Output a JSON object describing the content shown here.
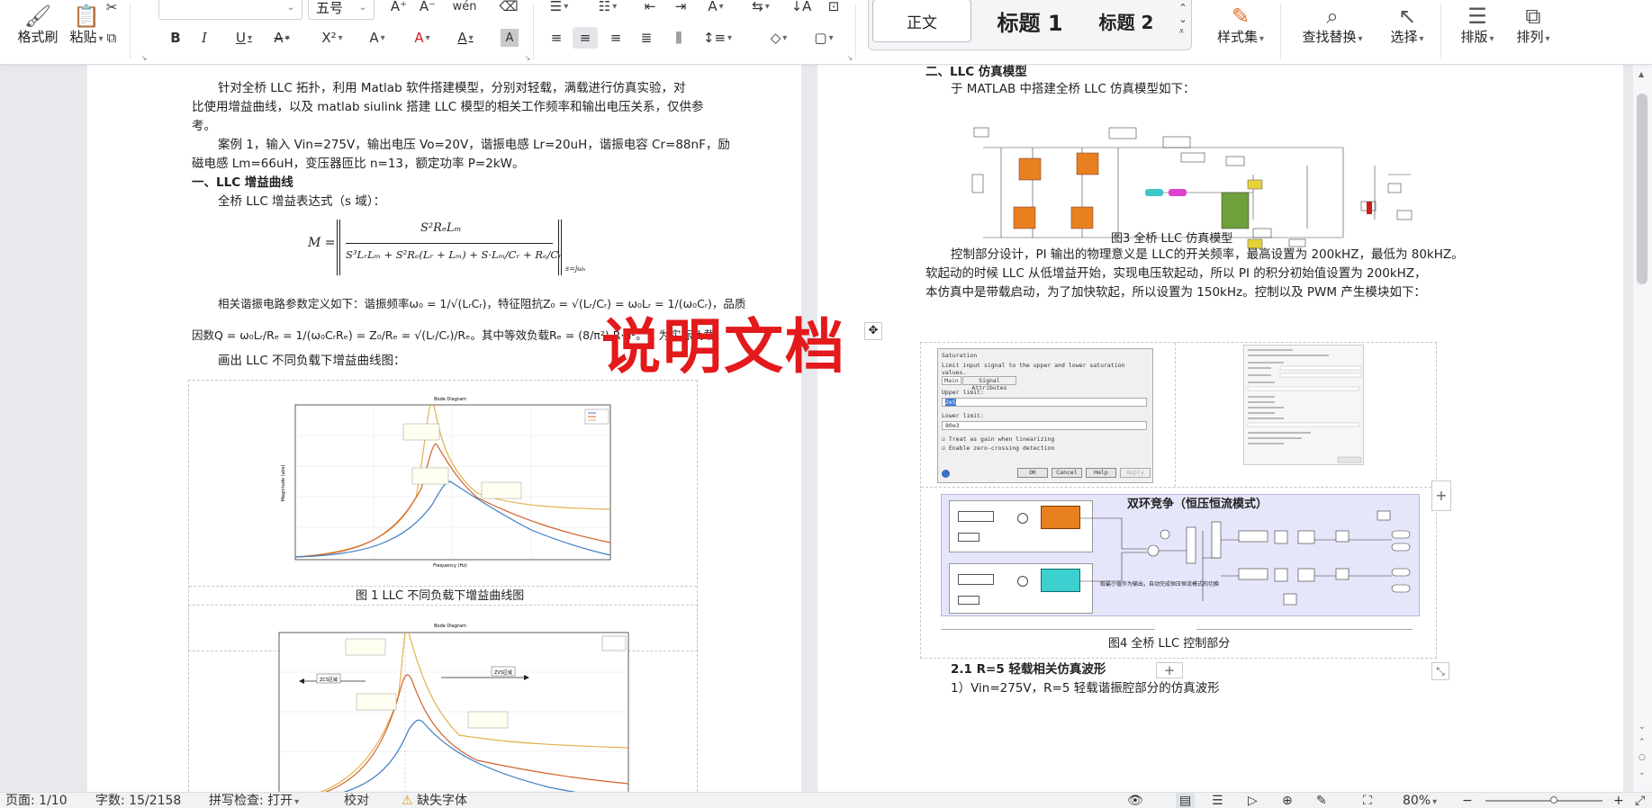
{
  "ribbon": {
    "format_painter": "格式刷",
    "paste": "粘贴",
    "font_name": "",
    "font_size": "五号",
    "style_normal": "正文",
    "style_h1": "标题 1",
    "style_h2": "标题 2",
    "style_set": "样式集",
    "find_replace": "查找替换",
    "select": "选择",
    "layout": "排版",
    "arrange": "排列"
  },
  "left_page": {
    "p1_l1": "针对全桥 LLC 拓扑，利用 Matlab 软件搭建模型，分别对轻载，满载进行仿真实验，对",
    "p1_l2": "比使用增益曲线，以及 matlab siulink 搭建 LLC 模型的相关工作频率和输出电压关系，仅供参",
    "p1_l3": "考。",
    "p2_l1": "案例 1，输入 Vin=275V，输出电压 Vo=20V，谐振电感 Lr=20uH，谐振电容 Cr=88nF，励",
    "p2_l2": "磁电感 Lm=66uH，变压器匝比 n=13，额定功率 P=2kW。",
    "h1": "一、LLC 增益曲线",
    "p3": "全桥 LLC 增益表达式（s 域）：",
    "formula_m": "M =",
    "formula_num": "S²RₑLₘ",
    "formula_den": "S³LᵣLₘ + S²Rₑ(Lᵣ + Lₘ) + S·Lₘ/Cᵣ + Rₑ/Cᵣ",
    "formula_sub": "s=jωₛ",
    "p4_l1": "相关谐振电路参数定义如下：谐振频率ω₀ = 1/√(LᵣCᵣ)，特征阻抗Z₀ = √(Lᵣ/Cᵣ) = ω₀Lᵣ = 1/(ω₀Cᵣ)，品质",
    "p4_l2": "因数Q = ω₀Lᵣ/Rₑ = 1/(ω₀CᵣRₑ) = Z₀/Rₑ = √(Lᵣ/Cᵣ)/Rₑ。其中等效负载Rₑ = (8/π²)·R·n²。R 为实际负载。",
    "p5": "画出 LLC 不同负载下增益曲线图：",
    "fig1_caption": "图 1 LLC 不同负载下增益曲线图",
    "plot1_title": "Bode Diagram",
    "plot1_xlabel": "Frequency (Hz)",
    "plot1_ylabel": "Magnitude (abs)",
    "plot2_title": "Bode Diagram",
    "plot2_left_label": "ZCS区域",
    "plot2_right_label": "ZVS区域"
  },
  "right_page": {
    "h2": "二、LLC 仿真模型",
    "p1": "于 MATLAB 中搭建全桥 LLC 仿真模型如下：",
    "fig3_caption": "图3  全桥 LLC 仿真模型",
    "p2_l1": "控制部分设计，PI 输出的物理意义是 LLC的开关频率，最高设置为 200kHZ，最低为 80kHZ。",
    "p2_l2": "软起动的时候 LLC 从低增益开始，实现电压软起动，所以 PI 的积分初始值设置为 200kHZ，",
    "p2_l3": "本仿真中是带载启动，为了加快软起，所以设置为 150kHz。控制以及 PWM 产生模块如下：",
    "sat_title": "Saturation",
    "sat_desc": "Limit input signal to the upper and lower saturation values.",
    "sat_tab_main": "Main",
    "sat_tab_signal": "Signal Attributes",
    "sat_upper_label": "Upper limit:",
    "sat_upper_value": "2e5",
    "sat_lower_label": "Lower limit:",
    "sat_lower_value": "80e3",
    "sat_chk1": "Treat as gain when linearizing",
    "sat_chk2": "Enable zero-crossing detection",
    "btn_ok": "OK",
    "btn_cancel": "Cancel",
    "btn_help": "Help",
    "btn_apply": "Apply",
    "control_title": "双环竞争（恒压恒流模式）",
    "control_note": "取最小值作为输出，自动完成恒压恒流模式的切换",
    "fig4_caption": "图4  全桥 LLC 控制部分",
    "h3": "2.1 R=5 轻载相关仿真波形",
    "p3": "1）Vin=275V，R=5 轻载谐振腔部分的仿真波形"
  },
  "watermark": "说明文档",
  "status": {
    "page": "页面: 1/10",
    "words": "字数: 15/2158",
    "spell": "拼写检查: 打开",
    "proof": "校对",
    "missing_font": "缺失字体",
    "zoom": "80%"
  },
  "colors": {
    "watermark": "#e3191b",
    "accent": "#2b6fd6",
    "curve_blue": "#3b7dc4",
    "curve_red": "#d0622c",
    "curve_yellow": "#e3b04a",
    "sim_orange": "#e8801f",
    "sim_green": "#6ea03c",
    "sim_yellow": "#e6d13a"
  }
}
